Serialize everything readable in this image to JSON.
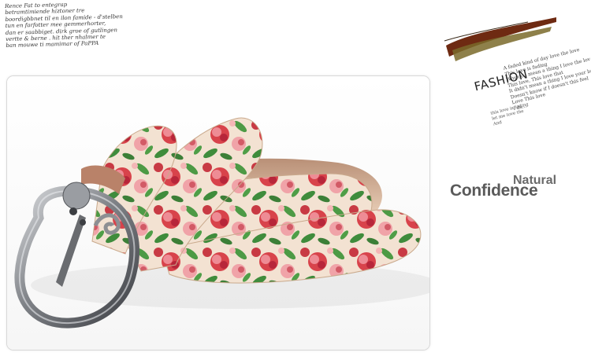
{
  "handwriting": {
    "lines": [
      "Rence Fat to entegrap",
      "betramtimiende hiztoner tre",
      "boordigbbnet til en ilon famide - d'stelben",
      "tun en farfotter mee gemmerhorter,",
      "dan er saabbiget. dirk groe of gutlingen",
      "vertte & berne . hit ther nhalmer te",
      "ban mouwe ti mamimar of PaPPA"
    ]
  },
  "product": {
    "image_label": "floral print leather belt with silver pin buckle"
  },
  "fashion_card": {
    "title": "FASHION",
    "lines": [
      "A faded kind of day love the love",
      "This love is fading",
      "Why do i mean a thing I love the love",
      "This love, This love that",
      "It didn't mean a thing I love your bag",
      "Doesn't know if I doesn't this feel",
      "Love This love",
      "I ds..."
    ],
    "lower_lines": [
      "this love is fading",
      "let me love the",
      "And"
    ]
  },
  "slogan": {
    "small_word": "Natural",
    "big_word": "Confidence"
  },
  "colors": {
    "belt_base": "#f3e2d2",
    "rose_red": "#d8434b",
    "rose_pink": "#ee8c95",
    "leaf_green": "#3f8c3c",
    "buckle_silver": "#8d8f93",
    "brush_brown": "#6e2a12"
  }
}
